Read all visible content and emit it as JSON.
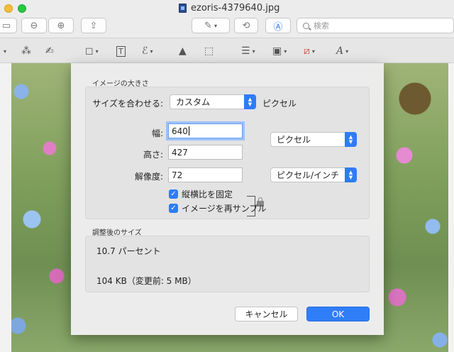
{
  "window": {
    "title": "ezoris-4379640.jpg"
  },
  "toolbar": {
    "search_placeholder": "検索"
  },
  "dialog": {
    "image_size_section": "イメージの大きさ",
    "fit_label": "サイズを合わせる:",
    "fit_value": "カスタム",
    "fit_unit": "ピクセル",
    "width_label": "幅:",
    "width_value": "640",
    "height_label": "高さ:",
    "height_value": "427",
    "unit_value": "ピクセル",
    "resolution_label": "解像度:",
    "resolution_value": "72",
    "resolution_unit": "ピクセル/インチ",
    "scale_proportionally": "縦横比を固定",
    "resample": "イメージを再サンプル",
    "result_section": "調整後のサイズ",
    "result_percent": "10.7 パーセント",
    "result_size": "104 KB（変更前: 5 MB）",
    "cancel_label": "キャンセル",
    "ok_label": "OK"
  },
  "colors": {
    "accent": "#2e7cf6",
    "traffic_yellow": "#f6bd3a",
    "traffic_green": "#27c840"
  }
}
